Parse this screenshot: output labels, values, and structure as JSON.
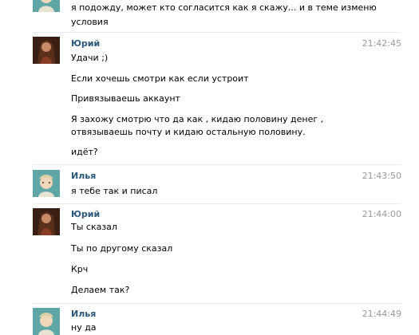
{
  "messages": [
    {
      "author": "",
      "time": "",
      "avatar": "ilya-avatar",
      "lines": [
        "я подожду, может кто согласится как я скажу... и в теме изменю",
        "условия"
      ]
    },
    {
      "author": "Юрий",
      "time": "21:42:45",
      "avatar": "yuri-avatar",
      "lines": [
        "Удачи ;)",
        "Если хочешь смотри как если устроит",
        "Привязываешь аккаунт",
        "Я захожу смотрю что да как , кидаю половину денег ,",
        "отвязываешь почту и кидаю остальную половину.",
        "идёт?"
      ]
    },
    {
      "author": "Илья",
      "time": "21:43:50",
      "avatar": "ilya-avatar",
      "lines": [
        "я тебе так и писал"
      ]
    },
    {
      "author": "Юрий",
      "time": "21:44:00",
      "avatar": "yuri-avatar",
      "lines": [
        "Ты сказал",
        "Ты по другому сказал",
        "Крч",
        "Делаем так?"
      ]
    },
    {
      "author": "Илья",
      "time": "21:44:49",
      "avatar": "ilya-avatar",
      "lines": [
        "ну да"
      ]
    }
  ],
  "colors": {
    "author": "#2b587a",
    "time": "#999999",
    "text": "#000000",
    "separator": "#e9edf1"
  }
}
